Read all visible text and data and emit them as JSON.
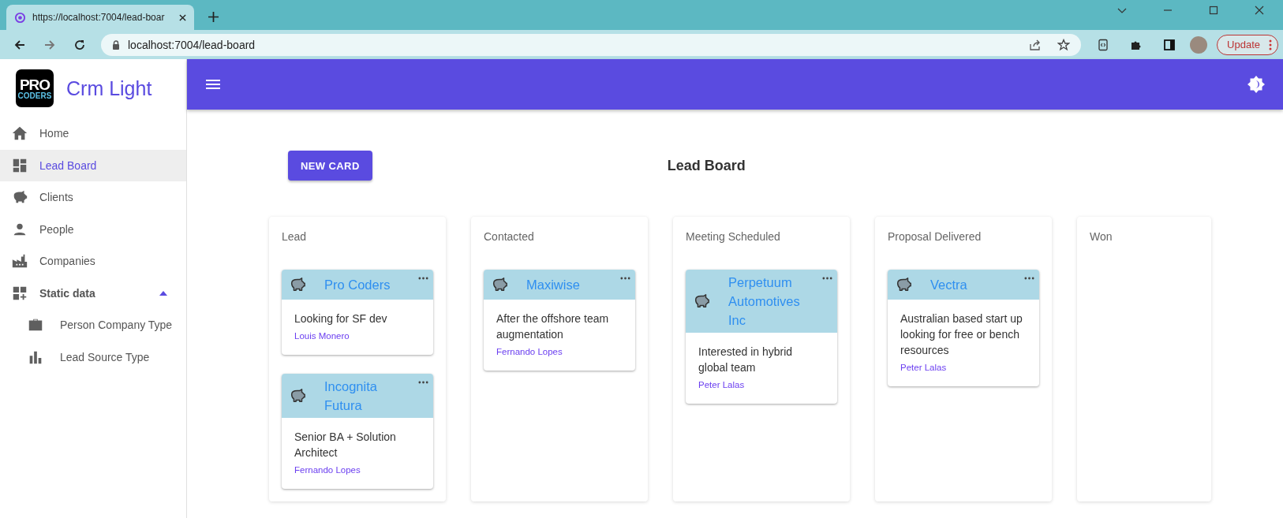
{
  "browser": {
    "tab_title": "https://localhost:7004/lead-boar",
    "address": "localhost:7004/lead-board",
    "update_button": "Update"
  },
  "app": {
    "logo": [
      "PRO",
      "CODERS"
    ],
    "name": "Crm Light"
  },
  "sidebar": {
    "items": [
      {
        "label": "Home",
        "selected": false
      },
      {
        "label": "Lead Board",
        "selected": true
      },
      {
        "label": "Clients",
        "selected": false
      },
      {
        "label": "People",
        "selected": false
      },
      {
        "label": "Companies",
        "selected": false
      },
      {
        "label": "Static data",
        "selected": false,
        "expanded": true,
        "children": [
          {
            "label": "Person Company Type",
            "selected": false
          },
          {
            "label": "Lead Source Type",
            "selected": false
          }
        ]
      }
    ]
  },
  "page": {
    "new_button": "NEW CARD",
    "title": "Lead Board"
  },
  "board": {
    "columns": [
      {
        "title": "Lead",
        "cards": [
          {
            "company": "Pro Coders",
            "description": "Looking for SF dev",
            "contact": "Louis Monero"
          },
          {
            "company": "Incognita Futura",
            "description": "Senior BA + Solution Architect",
            "contact": "Fernando Lopes"
          }
        ]
      },
      {
        "title": "Contacted",
        "cards": [
          {
            "company": "Maxiwise",
            "description": "After the offshore team augmentation",
            "contact": "Fernando Lopes"
          }
        ]
      },
      {
        "title": "Meeting Scheduled",
        "cards": [
          {
            "company": "Perpetuum Automotives Inc",
            "description": "Interested in hybrid global team",
            "contact": "Peter Lalas"
          }
        ]
      },
      {
        "title": "Proposal Delivered",
        "cards": [
          {
            "company": "Vectra",
            "description": "Australian based start up looking for free or bench resources",
            "contact": "Peter Lalas"
          }
        ]
      },
      {
        "title": "Won"
      }
    ]
  }
}
